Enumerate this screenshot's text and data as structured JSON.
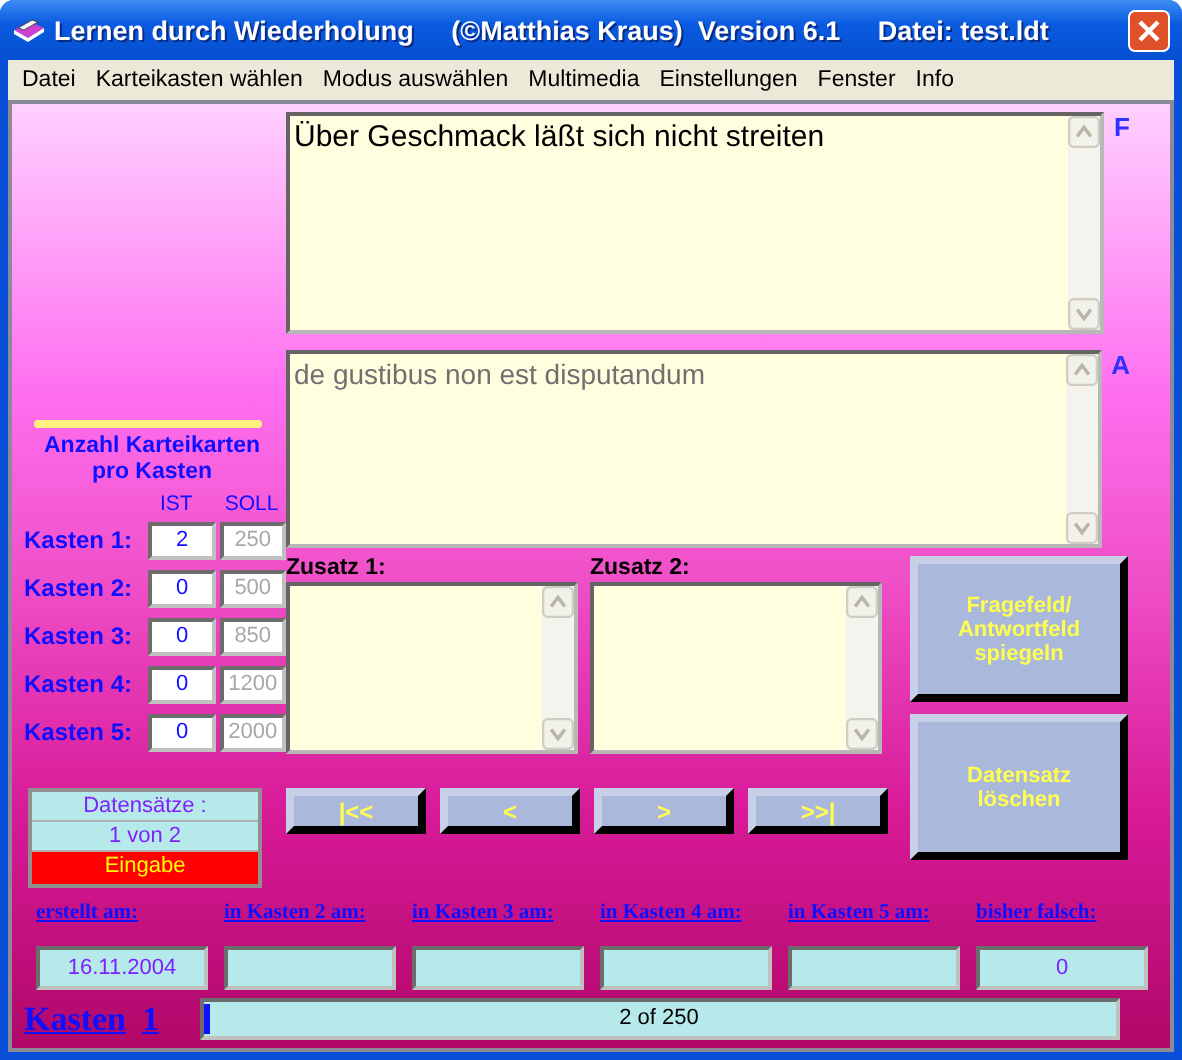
{
  "window": {
    "title": "Lernen durch Wiederholung     (©Matthias Kraus)  Version 6.1     Datei: test.ldt"
  },
  "menu": [
    "Datei",
    "Karteikasten wählen",
    "Modus auswählen",
    "Multimedia",
    "Einstellungen",
    "Fenster",
    "Info"
  ],
  "question": {
    "marker": "F",
    "value": "Über Geschmack läßt sich nicht streiten"
  },
  "answer": {
    "marker": "A",
    "value": "de gustibus non est disputandum"
  },
  "boxes_panel": {
    "heading": "Anzahl Karteikarten pro Kasten",
    "ist_label": "IST",
    "soll_label": "SOLL",
    "rows": [
      {
        "label": "Kasten 1:",
        "ist": "2",
        "soll": "250"
      },
      {
        "label": "Kasten 2:",
        "ist": "0",
        "soll": "500"
      },
      {
        "label": "Kasten 3:",
        "ist": "0",
        "soll": "850"
      },
      {
        "label": "Kasten 4:",
        "ist": "0",
        "soll": "1200"
      },
      {
        "label": "Kasten 5:",
        "ist": "0",
        "soll": "2000"
      }
    ]
  },
  "records": {
    "label": "Datensätze :",
    "position": "1 von  2",
    "mode": "Eingabe"
  },
  "extras": [
    {
      "label": "Zusatz 1:"
    },
    {
      "label": "Zusatz 2:"
    }
  ],
  "actions": [
    "Fragefeld/ Antwortfeld spiegeln",
    "Datensatz löschen"
  ],
  "navigation": [
    "|<<",
    "<",
    ">",
    ">>|"
  ],
  "dates": [
    {
      "label": "erstellt am:",
      "value": "16.11.2004"
    },
    {
      "label": "in Kasten 2 am:"
    },
    {
      "label": "in Kasten 3 am:"
    },
    {
      "label": "in Kasten 4 am:"
    },
    {
      "label": "in Kasten 5 am:"
    },
    {
      "label": "bisher falsch:",
      "value": "0"
    }
  ],
  "status": {
    "box_word": "Kasten",
    "box_number": "1",
    "progress_text": "2 of 250",
    "level": 0.008
  }
}
